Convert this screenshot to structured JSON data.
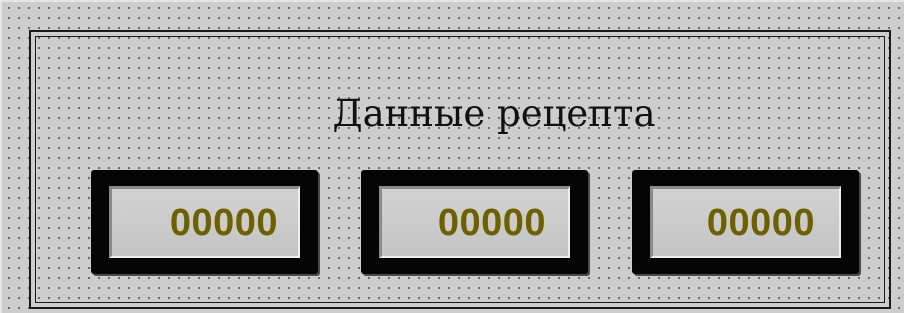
{
  "window": {
    "title": "Данные рецепта"
  },
  "fields": [
    {
      "value": "00000"
    },
    {
      "value": "00000"
    },
    {
      "value": "00000"
    }
  ],
  "colors": {
    "background": "#cdcdcd",
    "grid_dot": "#3a3a3a",
    "frame": "#1a1a1a",
    "field_bezel": "#050505",
    "field_face": "#c8c8c8",
    "value_text": "#6e6000"
  }
}
